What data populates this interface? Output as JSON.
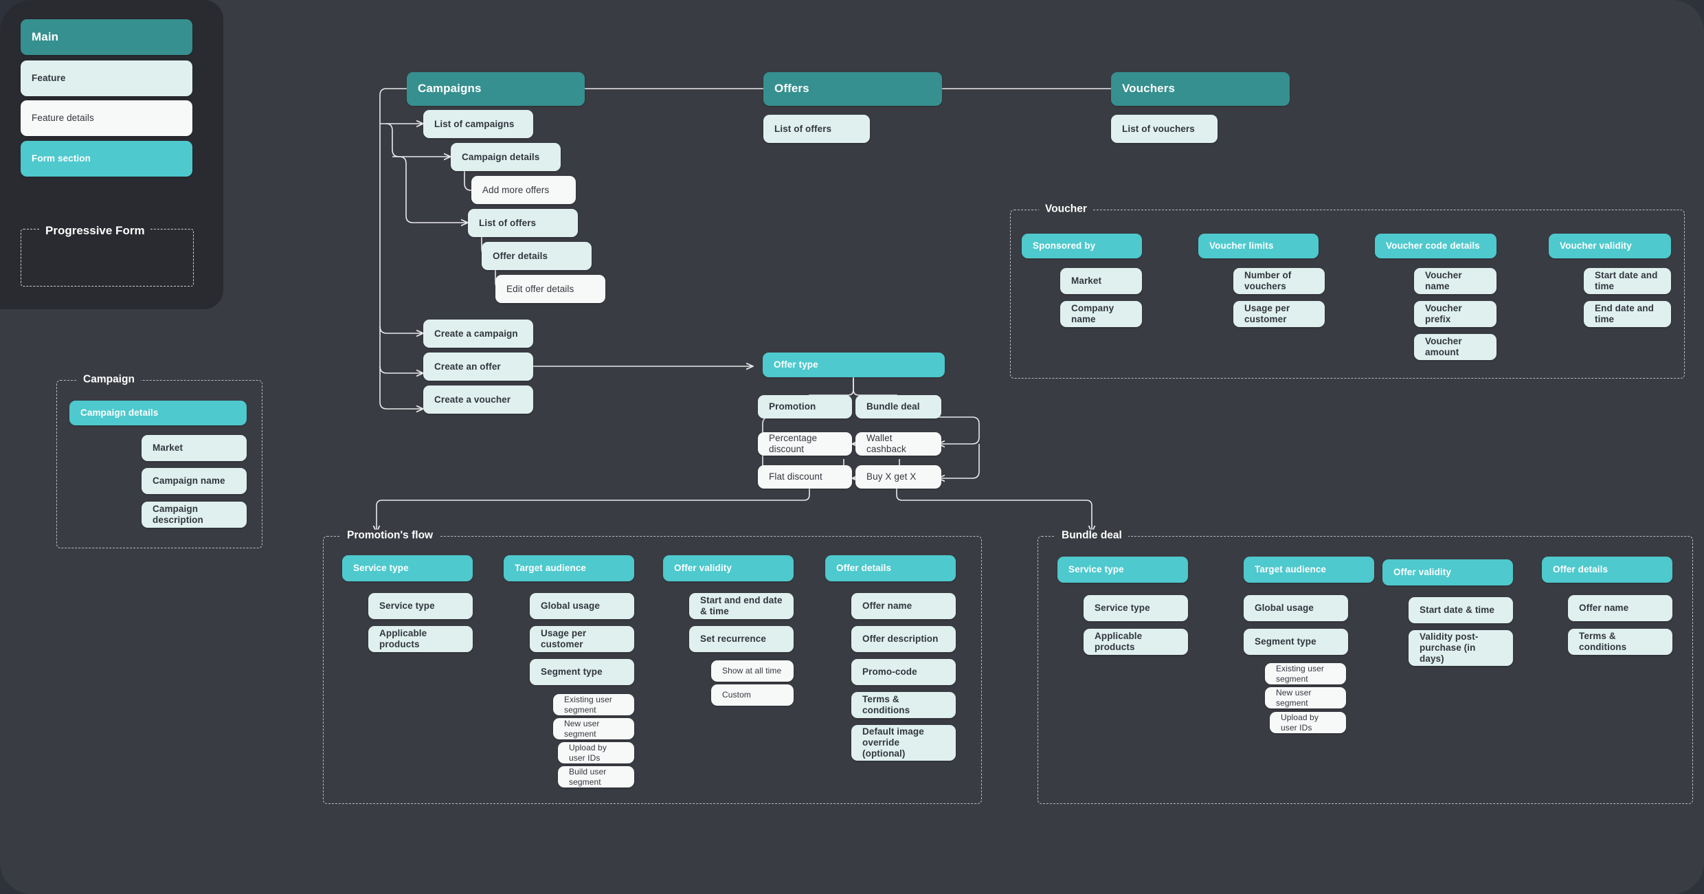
{
  "title": "Campaigns, Offers & Vouchers flow map",
  "colors": {
    "canvas_bg": "#3a3c43",
    "page_bg": "#2e323a",
    "legend_bg": "#292b30",
    "main_node": "#36908f",
    "feature_node": "#dff0ef",
    "feature_detail_node": "#f7f8f8",
    "form_section_node": "#4ec9cd",
    "connector": "#e9eaec",
    "frame_border": "#b9bcc2",
    "text_dark": "#32363d",
    "text_light": "#ffffff"
  },
  "legend": {
    "items": [
      {
        "label": "Main",
        "kind": "main"
      },
      {
        "label": "Feature",
        "kind": "feature"
      },
      {
        "label": "Feature details",
        "kind": "detail"
      },
      {
        "label": "Form section",
        "kind": "form"
      }
    ],
    "group_label": "Progressive Form"
  },
  "top_level": [
    {
      "label": "Campaigns",
      "kind": "main"
    },
    {
      "label": "Offers",
      "kind": "main"
    },
    {
      "label": "Vouchers",
      "kind": "main"
    }
  ],
  "campaigns_tree": [
    {
      "label": "List of campaigns",
      "kind": "feature"
    },
    {
      "label": "Campaign details",
      "kind": "feature"
    },
    {
      "label": "Add more offers",
      "kind": "detail"
    },
    {
      "label": "List of offers",
      "kind": "feature"
    },
    {
      "label": "Offer details",
      "kind": "feature"
    },
    {
      "label": "Edit offer details",
      "kind": "detail"
    },
    {
      "label": "Create a campaign",
      "kind": "feature"
    },
    {
      "label": "Create an offer",
      "kind": "feature"
    },
    {
      "label": "Create a voucher",
      "kind": "feature"
    }
  ],
  "offers_tree": [
    {
      "label": "List of offers",
      "kind": "feature"
    }
  ],
  "vouchers_tree": [
    {
      "label": "List of vouchers",
      "kind": "feature"
    }
  ],
  "offer_type": {
    "root": {
      "label": "Offer type",
      "kind": "form"
    },
    "branches": [
      {
        "label": "Promotion",
        "kind": "feature"
      },
      {
        "label": "Bundle deal",
        "kind": "feature"
      },
      {
        "label": "Percentage discount",
        "kind": "detail"
      },
      {
        "label": "Wallet cashback",
        "kind": "detail"
      },
      {
        "label": "Flat discount",
        "kind": "detail"
      },
      {
        "label": "Buy X get X",
        "kind": "detail"
      }
    ]
  },
  "campaign_group": {
    "title": "Campaign",
    "columns": [
      {
        "header": {
          "label": "Campaign details",
          "kind": "form"
        },
        "items": [
          {
            "label": "Market",
            "kind": "feature"
          },
          {
            "label": "Campaign name",
            "kind": "feature"
          },
          {
            "label": "Campaign description",
            "kind": "feature"
          }
        ]
      }
    ]
  },
  "voucher_group": {
    "title": "Voucher",
    "columns": [
      {
        "header": {
          "label": "Sponsored by",
          "kind": "form"
        },
        "items": [
          {
            "label": "Market",
            "kind": "feature"
          },
          {
            "label": "Company name",
            "kind": "feature"
          }
        ]
      },
      {
        "header": {
          "label": "Voucher limits",
          "kind": "form"
        },
        "items": [
          {
            "label": "Number of vouchers",
            "kind": "feature"
          },
          {
            "label": "Usage per customer",
            "kind": "feature"
          }
        ]
      },
      {
        "header": {
          "label": "Voucher code details",
          "kind": "form"
        },
        "items": [
          {
            "label": "Voucher name",
            "kind": "feature"
          },
          {
            "label": "Voucher prefix",
            "kind": "feature"
          },
          {
            "label": "Voucher amount",
            "kind": "feature"
          }
        ]
      },
      {
        "header": {
          "label": "Voucher validity",
          "kind": "form"
        },
        "items": [
          {
            "label": "Start date and time",
            "kind": "feature"
          },
          {
            "label": "End date and time",
            "kind": "feature"
          }
        ]
      }
    ]
  },
  "promotion_group": {
    "title": "Promotion's flow",
    "columns": [
      {
        "header": {
          "label": "Service type",
          "kind": "form"
        },
        "items": [
          {
            "label": "Service type",
            "kind": "feature"
          },
          {
            "label": "Applicable products",
            "kind": "feature"
          }
        ]
      },
      {
        "header": {
          "label": "Target audience",
          "kind": "form"
        },
        "items": [
          {
            "label": "Global usage",
            "kind": "feature"
          },
          {
            "label": "Usage per customer",
            "kind": "feature"
          },
          {
            "label": "Segment type",
            "kind": "feature"
          },
          {
            "label": "Existing user segment",
            "kind": "detail"
          },
          {
            "label": "New user segment",
            "kind": "detail"
          },
          {
            "label": "Upload by user IDs",
            "kind": "detail"
          },
          {
            "label": "Build user segment",
            "kind": "detail"
          }
        ]
      },
      {
        "header": {
          "label": "Offer validity",
          "kind": "form"
        },
        "items": [
          {
            "label": "Start and end date & time",
            "kind": "feature"
          },
          {
            "label": "Set recurrence",
            "kind": "feature"
          },
          {
            "label": "Show at all time",
            "kind": "detail"
          },
          {
            "label": "Custom",
            "kind": "detail"
          }
        ]
      },
      {
        "header": {
          "label": "Offer details",
          "kind": "form"
        },
        "items": [
          {
            "label": "Offer name",
            "kind": "feature"
          },
          {
            "label": "Offer description",
            "kind": "feature"
          },
          {
            "label": "Promo-code",
            "kind": "feature"
          },
          {
            "label": "Terms & conditions",
            "kind": "feature"
          },
          {
            "label": "Default image override (optional)",
            "kind": "feature"
          }
        ]
      }
    ]
  },
  "bundle_group": {
    "title": "Bundle deal",
    "columns": [
      {
        "header": {
          "label": "Service type",
          "kind": "form"
        },
        "items": [
          {
            "label": "Service type",
            "kind": "feature"
          },
          {
            "label": "Applicable products",
            "kind": "feature"
          }
        ]
      },
      {
        "header": {
          "label": "Target audience",
          "kind": "form"
        },
        "items": [
          {
            "label": "Global usage",
            "kind": "feature"
          },
          {
            "label": "Segment type",
            "kind": "feature"
          },
          {
            "label": "Existing user segment",
            "kind": "detail"
          },
          {
            "label": "New user segment",
            "kind": "detail"
          },
          {
            "label": "Upload by user IDs",
            "kind": "detail"
          }
        ]
      },
      {
        "header": {
          "label": "Offer validity",
          "kind": "form"
        },
        "items": [
          {
            "label": "Start date & time",
            "kind": "feature"
          },
          {
            "label": "Validity post-purchase (in days)",
            "kind": "feature"
          }
        ]
      },
      {
        "header": {
          "label": "Offer details",
          "kind": "form"
        },
        "items": [
          {
            "label": "Offer name",
            "kind": "feature"
          },
          {
            "label": "Terms & conditions",
            "kind": "feature"
          }
        ]
      }
    ]
  }
}
